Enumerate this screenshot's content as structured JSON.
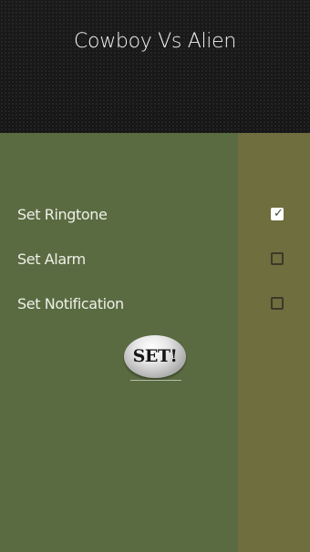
{
  "header": {
    "title": "Cowboy Vs Alien"
  },
  "options": [
    {
      "label": "Set Ringtone",
      "checked": true
    },
    {
      "label": "Set Alarm",
      "checked": false
    },
    {
      "label": "Set Notification",
      "checked": false
    }
  ],
  "set_button": {
    "label": "SET!"
  },
  "icons": {
    "checkmark": "checkmark-icon"
  },
  "colors": {
    "content_bg": "#5a6b42",
    "strip_bg": "#6e6e3e",
    "header_bg": "#0b0b0b"
  }
}
